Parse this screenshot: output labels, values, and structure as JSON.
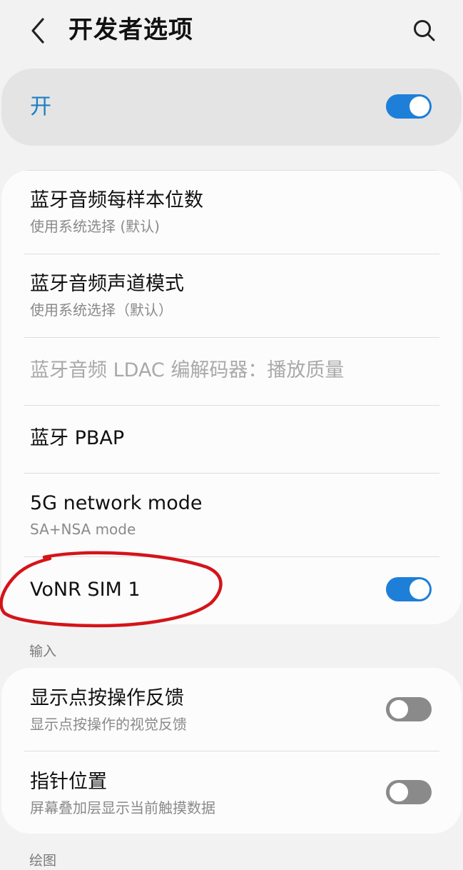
{
  "header": {
    "title": "开发者选项",
    "back_icon": "chevron-left-icon",
    "search_icon": "search-icon"
  },
  "master_switch": {
    "label": "开",
    "state": true
  },
  "settings_group_1": {
    "items": [
      {
        "title": "蓝牙音频每样本位数",
        "subtitle": "使用系统选择 (默认)"
      },
      {
        "title": "蓝牙音频声道模式",
        "subtitle": "使用系统选择（默认）"
      },
      {
        "title": "蓝牙音频 LDAC 编解码器：播放质量",
        "disabled": true
      },
      {
        "title": "蓝牙 PBAP"
      },
      {
        "title": "5G network mode",
        "subtitle": "SA+NSA mode"
      },
      {
        "title": "VoNR SIM 1",
        "toggle": true
      }
    ]
  },
  "section_input": {
    "label": "输入"
  },
  "settings_group_2": {
    "items": [
      {
        "title": "显示点按操作反馈",
        "subtitle": "显示点按操作的视觉反馈",
        "toggle": false
      },
      {
        "title": "指针位置",
        "subtitle": "屏幕叠加层显示当前触摸数据",
        "toggle": false
      }
    ]
  },
  "section_drawing": {
    "label": "绘图"
  },
  "colors": {
    "accent": "#1e7fd8",
    "master_label": "#1d7fc4",
    "annotation": "#d4141a"
  }
}
